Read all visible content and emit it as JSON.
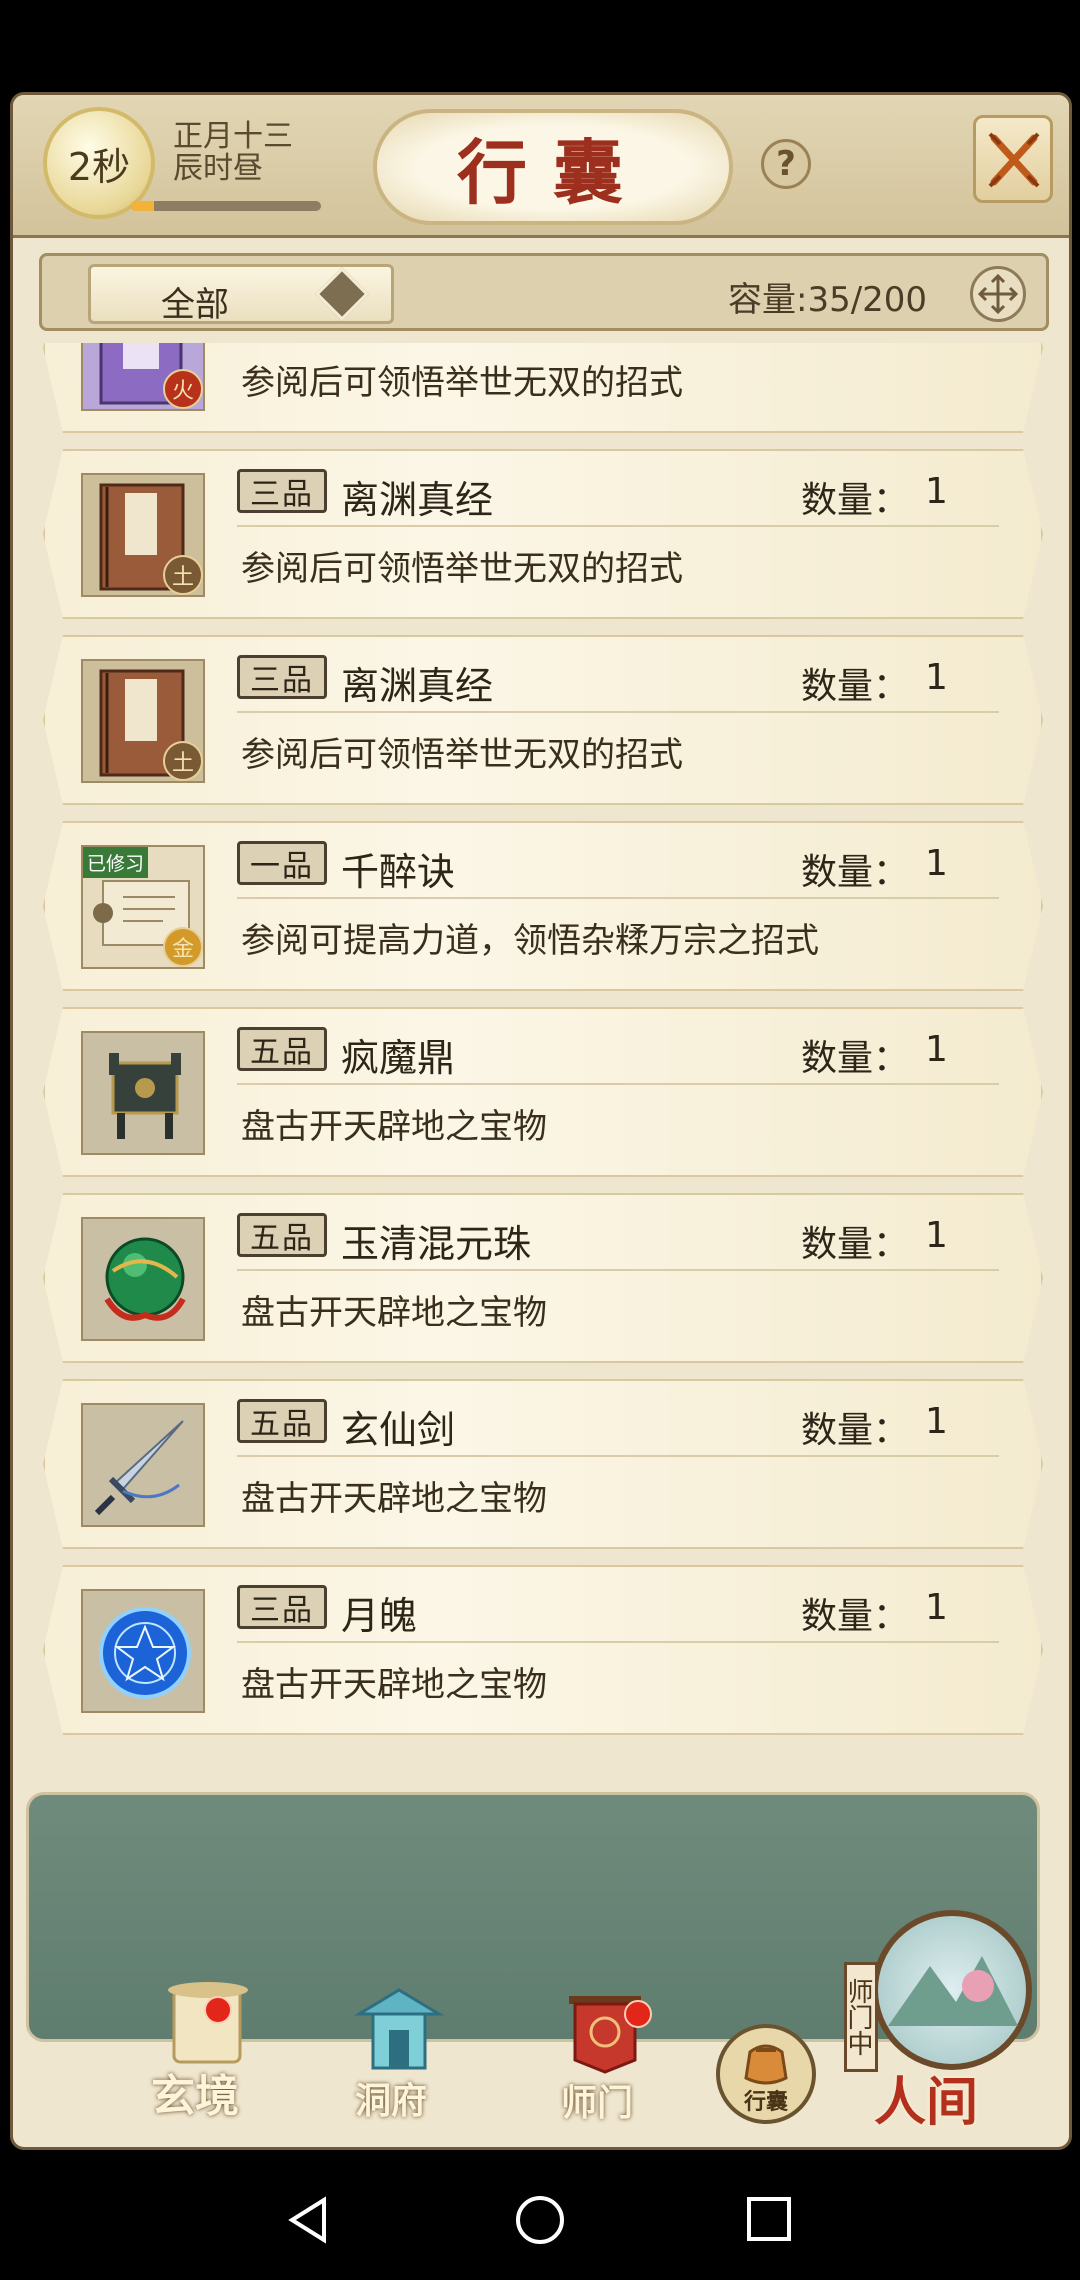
{
  "header": {
    "timer": "2秒",
    "date_line1": "正月十三",
    "date_line2": "辰时昼",
    "day_progress": 0.12,
    "title": "行囊",
    "help": "?"
  },
  "filter": {
    "selected": "全部",
    "capacity": "容量:35/200"
  },
  "qty_label": "数量：",
  "items": [
    {
      "grade": "",
      "name": "",
      "qty": "",
      "desc": "参阅后可领悟举世无双的招式",
      "element": "火",
      "icon": "purple-manual-icon"
    },
    {
      "grade": "三品",
      "name": "离渊真经",
      "qty": "1",
      "desc": "参阅后可领悟举世无双的招式",
      "element": "土",
      "icon": "brown-manual-icon"
    },
    {
      "grade": "三品",
      "name": "离渊真经",
      "qty": "1",
      "desc": "参阅后可领悟举世无双的招式",
      "element": "土",
      "icon": "brown-manual-icon"
    },
    {
      "grade": "一品",
      "name": "千醉诀",
      "qty": "1",
      "desc": "参阅可提高力道，领悟杂糅万宗之招式",
      "element": "金",
      "icon": "scroll-icon",
      "tag": "已修习"
    },
    {
      "grade": "五品",
      "name": "疯魔鼎",
      "qty": "1",
      "desc": "盘古开天辟地之宝物",
      "icon": "cauldron-icon"
    },
    {
      "grade": "五品",
      "name": "玉清混元珠",
      "qty": "1",
      "desc": "盘古开天辟地之宝物",
      "icon": "jade-orb-icon"
    },
    {
      "grade": "五品",
      "name": "玄仙剑",
      "qty": "1",
      "desc": "盘古开天辟地之宝物",
      "icon": "sword-icon"
    },
    {
      "grade": "三品",
      "name": "月魄",
      "qty": "1",
      "desc": "盘古开天辟地之宝物",
      "icon": "moon-orb-icon"
    }
  ],
  "nav": {
    "xuanjing": "玄境",
    "dongfu": "洞府",
    "shimen": "师门",
    "xingnang": "行囊",
    "status": "师门中",
    "renjian": "人间"
  }
}
